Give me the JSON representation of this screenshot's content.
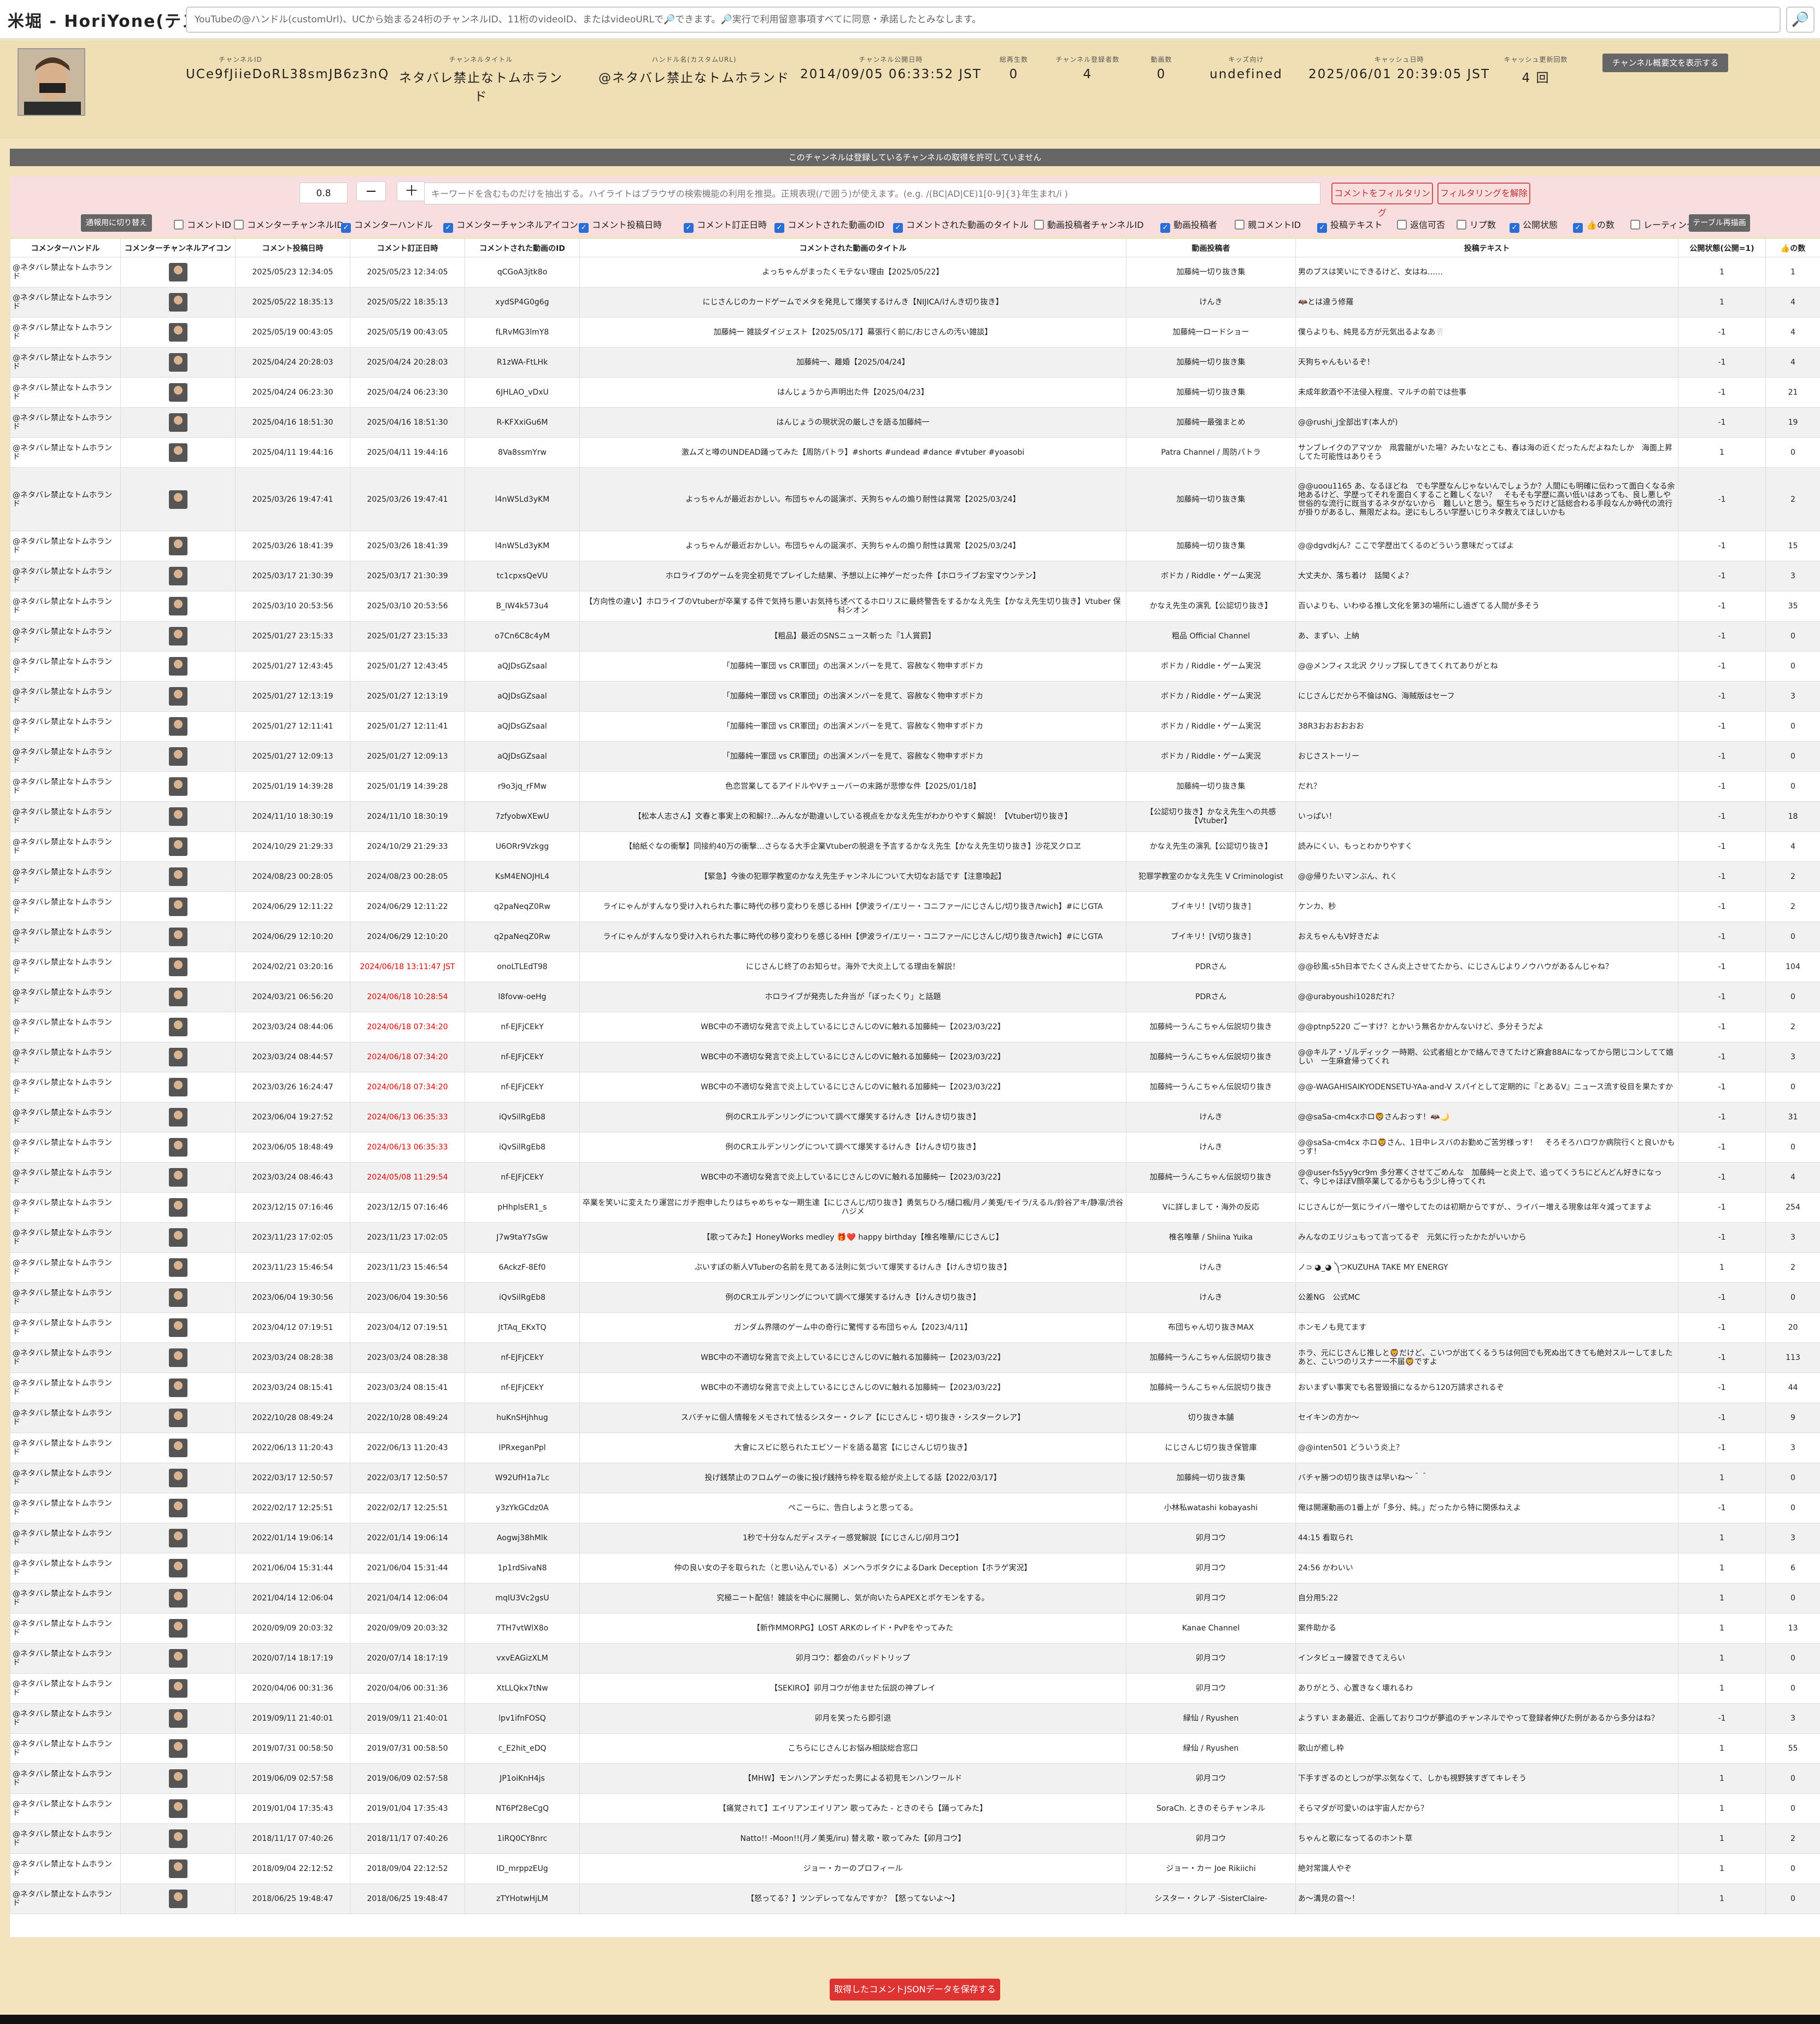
{
  "app_title": "米堀 - HoriYone(テスト中)",
  "search_placeholder": "YouTubeの@ハンドル(customUrl)、UCから始まる24桁のチャンネルID、11桁のvideoID、またはvideoURLで🔎できます。🔎実行で利用留意事項すべてに同意・承諾したとみなします。",
  "search_icon": "🔎",
  "header": [
    {
      "label": "チャンネルID",
      "value": "UCe9fJiieDoRL38smJB6z3nQ"
    },
    {
      "label": "チャンネルタイトル",
      "value": "ネタバレ禁止なトムホランド"
    },
    {
      "label": "ハンドル名(カスタムURL)",
      "value": "@ネタバレ禁止なトムホランド"
    },
    {
      "label": "チャンネル公開日時",
      "value": "2014/09/05 06:33:52 JST"
    },
    {
      "label": "総再生数",
      "value": "0"
    },
    {
      "label": "チャンネル登録者数",
      "value": "4"
    },
    {
      "label": "動画数",
      "value": "0"
    },
    {
      "label": "キッズ向け",
      "value": "undefined"
    },
    {
      "label": "キャッシュ日時",
      "value": "2025/06/01 20:39:05 JST"
    },
    {
      "label": "キャッシュ更新回数",
      "value": "4 回"
    }
  ],
  "desc_button": "チャンネル概要文を表示する",
  "notice": "このチャンネルは登録しているチャンネルの取得を許可していません",
  "filter": {
    "zoom": "0.8",
    "minus": "−",
    "plus": "＋",
    "keyword_placeholder": "キーワードを含むものだけを抽出する。ハイライトはブラウザの検索機能の利用を推奨。正規表現(/で囲う)が使えます。(e.g. /(BC|AD|CE)1[0-9]{3}年生まれ/i )",
    "filter_button": "コメントをフィルタリング",
    "clear_button": "フィルタリングを解除",
    "mode_button": "通報用に切り替え",
    "redraw_button": "テーブル再描画"
  },
  "checkboxes": [
    {
      "label": "コメントID",
      "checked": false
    },
    {
      "label": "コメンターチャンネルID",
      "checked": false
    },
    {
      "label": "コメンターハンドル",
      "checked": true
    },
    {
      "label": "コメンターチャンネルアイコン",
      "checked": true
    },
    {
      "label": "コメント投稿日時",
      "checked": true
    },
    {
      "label": "コメント訂正日時",
      "checked": true
    },
    {
      "label": "コメントされた動画のID",
      "checked": true
    },
    {
      "label": "コメントされた動画のタイトル",
      "checked": true
    },
    {
      "label": "動画投稿者チャンネルID",
      "checked": false
    },
    {
      "label": "動画投稿者",
      "checked": true
    },
    {
      "label": "親コメントID",
      "checked": false
    },
    {
      "label": "投稿テキスト",
      "checked": true
    },
    {
      "label": "返信可否",
      "checked": false
    },
    {
      "label": "リプ数",
      "checked": false
    },
    {
      "label": "公開状態",
      "checked": true
    },
    {
      "label": "👍の数",
      "checked": true
    },
    {
      "label": "レーティング",
      "checked": false
    }
  ],
  "columns": [
    "コメンターハンドル",
    "コメンターチャンネルアイコン",
    "コメント投稿日時",
    "コメント訂正日時",
    "コメントされた動画のID",
    "コメントされた動画のタイトル",
    "動画投稿者",
    "投稿テキスト",
    "公開状態(公開=1)",
    "👍の数"
  ],
  "handle": "@ネタバレ禁止なトムホランド",
  "rows": [
    [
      "2025/05/23 12:34:05",
      "2025/05/23 12:34:05",
      "qCGoA3jtk8o",
      "よっちゃんがまったくモテない理由【2025/05/22】",
      "加藤純一切り抜き集",
      "男のブスは笑いにできるけど、女はね……",
      "1",
      "1"
    ],
    [
      "2025/05/22 18:35:13",
      "2025/05/22 18:35:13",
      "xydSP4G0g6g",
      "にじさんじのカードゲームでメタを発見して爆笑するけんき【NIJICA/けんき切り抜き】",
      "けんき",
      "🦇とは違う修羅",
      "1",
      "4"
    ],
    [
      "2025/05/19 00:43:05",
      "2025/05/19 00:43:05",
      "fLRvMG3lmY8",
      "加藤純一 雑談ダイジェスト【2025/05/17】幕張行く前に/おじさんの汚い雑談】",
      "加藤純一ロードショー",
      "僕らよりも、純見る方が元気出るよなあ🦷",
      "-1",
      "4"
    ],
    [
      "2025/04/24 20:28:03",
      "2025/04/24 20:28:03",
      "R1zWA-FtLHk",
      "加藤純一、離婚【2025/04/24】",
      "加藤純一切り抜き集",
      "天狗ちゃんもいるぞ！",
      "-1",
      "4"
    ],
    [
      "2025/04/24 06:23:30",
      "2025/04/24 06:23:30",
      "6JHLAO_vDxU",
      "はんじょうから声明出た件【2025/04/23】",
      "加藤純一切り抜き集",
      "未成年飲酒や不法侵入程度、マルチの前では些事",
      "-1",
      "21"
    ],
    [
      "2025/04/16 18:51:30",
      "2025/04/16 18:51:30",
      "R-KFXxiGu6M",
      "はんじょうの現状況の厳しさを語る加藤純一",
      "加藤純一最強まとめ",
      "@@rushi_j全部出す(本人が)",
      "-1",
      "19"
    ],
    [
      "2025/04/11 19:44:16",
      "2025/04/11 19:44:16",
      "8Va8ssmYrw",
      "激ムズと噂のUNDEAD踊ってみた【周防パトラ】#shorts #undead #dance #vtuber #yoasobi",
      "Patra Channel / 周防パトラ",
      "サンブレイクのアマツか　凧雲龍がいた場？みたいなとこも、春は海の近くだったんだよねたしか　海面上昇してた可能性はありそう",
      "1",
      "0"
    ],
    [
      "2025/03/26 19:47:41",
      "2025/03/26 19:47:41",
      "l4nW5Ld3yKM",
      "よっちゃんが最近おかしい。布団ちゃんの誕演ボ、天狗ちゃんの煽り耐性は異常【2025/03/24】",
      "加藤純一切り抜き集",
      "@@uoou1165 あ、なるほどね　でも学歴なんじゃないんでしょうか？人間にも明確に伝わって面白くなる余地あるけど、学歴ってそれを面白くすること難しくない？　そもそも学歴に高い低いはあっても、良し悪しや世俗的な流行に既当するネタがないから　難しいと思う。駆生ちゃうだけど話総合わる手段なんか時代の流行が掛りがあるし、無限だよね。逆にもしろい学歴いじりネタ教えてほしいかも",
      "-1",
      "2"
    ],
    [
      "2025/03/26 18:41:39",
      "2025/03/26 18:41:39",
      "l4nW5Ld3yKM",
      "よっちゃんが最近おかしい。布団ちゃんの誕演ボ、天狗ちゃんの煽り耐性は異常【2025/03/24】",
      "加藤純一切り抜き集",
      "@@dgvdkjん？ここで学歴出てくるのどういう意味だってばよ",
      "-1",
      "15"
    ],
    [
      "2025/03/17 21:30:39",
      "2025/03/17 21:30:39",
      "tc1cpxsQeVU",
      "ホロライブのゲームを完全初見でプレイした結果、予想以上に神ゲーだった件【ホロライブお宝マウンテン】",
      "ボドカ / Riddle・ゲーム実況",
      "大丈夫か、落ち着け　話聞くよ？",
      "-1",
      "3"
    ],
    [
      "2025/03/10 20:53:56",
      "2025/03/10 20:53:56",
      "B_IW4k573u4",
      "【方向性の違い】ホロライブのVtuberが卒業する件で気持ち悪いお気持ち述べてるホロリスに最終警告をするかなえ先生【かなえ先生切り抜き】Vtuber 保科シオン",
      "かなえ先生の演乳【公認切り抜き】",
      "百いよりも、いわゆる推し文化を第3の場所にし過ぎてる人間が多そう",
      "-1",
      "35"
    ],
    [
      "2025/01/27 23:15:33",
      "2025/01/27 23:15:33",
      "o7Cn6C8c4yM",
      "【粗品】最近のSNSニュース斬った『1人賞罰】",
      "粗品 Official Channel",
      "あ、まずい、上納",
      "-1",
      "0"
    ],
    [
      "2025/01/27 12:43:45",
      "2025/01/27 12:43:45",
      "aQJDsGZsaal",
      "「加藤純一軍団 vs CR軍団」の出演メンバーを見て、容赦なく物申すボドカ",
      "ボドカ / Riddle・ゲーム実況",
      "@@メンフィス北沢 クリップ探してきてくれてありがとね",
      "-1",
      "0"
    ],
    [
      "2025/01/27 12:13:19",
      "2025/01/27 12:13:19",
      "aQJDsGZsaal",
      "「加藤純一軍団 vs CR軍団」の出演メンバーを見て、容赦なく物申すボドカ",
      "ボドカ / Riddle・ゲーム実況",
      "にじさんじだから不倫はNG、海賊版はセーフ",
      "-1",
      "3"
    ],
    [
      "2025/01/27 12:11:41",
      "2025/01/27 12:11:41",
      "aQJDsGZsaal",
      "「加藤純一軍団 vs CR軍団」の出演メンバーを見て、容赦なく物申すボドカ",
      "ボドカ / Riddle・ゲーム実況",
      "38R3おおおおおお",
      "-1",
      "0"
    ],
    [
      "2025/01/27 12:09:13",
      "2025/01/27 12:09:13",
      "aQJDsGZsaal",
      "「加藤純一軍団 vs CR軍団」の出演メンバーを見て、容赦なく物申すボドカ",
      "ボドカ / Riddle・ゲーム実況",
      "おじさストーリー",
      "-1",
      "0"
    ],
    [
      "2025/01/19 14:39:28",
      "2025/01/19 14:39:28",
      "r9o3jq_rFMw",
      "色恋営業してるアイドルやVチューバーの末路が悲惨な件【2025/01/18】",
      "加藤純一切り抜き集",
      "だれ？",
      "-1",
      "0"
    ],
    [
      "2024/11/10 18:30:19",
      "2024/11/10 18:30:19",
      "7zfyobwXEwU",
      "【松本人志さん】文春と事実上の和解!?…みんなが勘違いしている視点をかなえ先生がわかりやすく解説！【Vtuber切り抜き】",
      "【公認切り抜き】かなえ先生への共感【Vtuber】",
      "いっぱい！",
      "-1",
      "18"
    ],
    [
      "2024/10/29 21:29:33",
      "2024/10/29 21:29:33",
      "U6ORr9Vzkgg",
      "【給紙ぐなの衝撃】同接約40万の衝撃…さらなる大手企業Vtuberの脱退を予言するかなえ先生【かなえ先生切り抜き】沙花叉クロヱ",
      "かなえ先生の演乳【公認切り抜き】",
      "読みにくい、もっとわかりやすく",
      "-1",
      "4"
    ],
    [
      "2024/08/23 00:28:05",
      "2024/08/23 00:28:05",
      "KsM4ENOJHL4",
      "【緊急】今後の犯罪学教室のかなえ先生チャンネルについて大切なお話です【注意喚起】",
      "犯罪学教室のかなえ先生 V Criminologist",
      "@@帰りたいマンぶん、れく",
      "-1",
      "2"
    ],
    [
      "2024/06/29 12:11:22",
      "2024/06/29 12:11:22",
      "q2paNeqZ0Rw",
      "ライにゃんがすんなり受け入れられた事に時代の移り変わりを感じるHH【伊波ライ/エリー・コニファー/にじさんじ/切り抜き/twich】#にじGTA",
      "ブイキリ！[V切り抜き]",
      "ケンカ、秒",
      "-1",
      "2"
    ],
    [
      "2024/06/29 12:10:20",
      "2024/06/29 12:10:20",
      "q2paNeqZ0Rw",
      "ライにゃんがすんなり受け入れられた事に時代の移り変わりを感じるHH【伊波ライ/エリー・コニファー/にじさんじ/切り抜き/twich】#にじGTA",
      "ブイキリ！[V切り抜き]",
      "おえちゃんもV好きだよ",
      "-1",
      "0"
    ],
    [
      "2024/02/21 03:20:16",
      "2024/06/18 13:11:47 JST",
      "onoLTLEdT98",
      "にじさんじ終了のお知らせ。海外で大炎上してる理由を解説！",
      "PDRさん",
      "@@砂風-s5h日本でたくさん炎上させてたから、にじさんじよりノウハウがあるんじゃね？",
      "-1",
      "104"
    ],
    [
      "2024/03/21 06:56:20",
      "2024/06/18 10:28:54",
      "l8fovw-oeHg",
      "ホロライブが発売した弁当が「ぼったくり」と話題",
      "PDRさん",
      "@@urabyoushi1028だれ？",
      "-1",
      "0"
    ],
    [
      "2023/03/24 08:44:06",
      "2024/06/18 07:34:20",
      "nf-EJFjCEkY",
      "WBC中の不適切な発言で炎上しているにじさんじのVに触れる加藤純一【2023/03/22】",
      "加藤純一うんこちゃん伝説切り抜き",
      "@@ptnp5220 ごーすけ？とかいう無名かかんないけど、多分そうだよ",
      "-1",
      "2"
    ],
    [
      "2023/03/24 08:44:57",
      "2024/06/18 07:34:20",
      "nf-EJFjCEkY",
      "WBC中の不適切な発言で炎上しているにじさんじのVに触れる加藤純一【2023/03/22】",
      "加藤純一うんこちゃん伝説切り抜き",
      "@@キルア・ゾルディック 一時期、公式者組とかで絡んできてたけど麻倉88Aになってから閉じコンしてて嬉しい　一生麻倉帰ってくれ",
      "-1",
      "3"
    ],
    [
      "2023/03/26 16:24:47",
      "2024/06/18 07:34:20",
      "nf-EJFjCEkY",
      "WBC中の不適切な発言で炎上しているにじさんじのVに触れる加藤純一【2023/03/22】",
      "加藤純一うんこちゃん伝説切り抜き",
      "@@-WAGAHISAIKYODENSETU-YAa-and-V スパイとして定期的に『とあるV』ニュース流す役目を果たすか",
      "-1",
      "0"
    ],
    [
      "2023/06/04 19:27:52",
      "2024/06/13 06:35:33",
      "iQvSilRgEb8",
      "例のCRエルデンリングについて調べて爆笑するけんき【けんき切り抜き】",
      "けんき",
      "@@saSa-cm4cxホロ🦁さんおっす！🦇🌙",
      "-1",
      "31"
    ],
    [
      "2023/06/05 18:48:49",
      "2024/06/13 06:35:33",
      "iQvSilRgEb8",
      "例のCRエルデンリングについて調べて爆笑するけんき【けんき切り抜き】",
      "けんき",
      "@@saSa-cm4cx ホロ🦁さん、1日中レスバのお勤めご苦労様っす！　そろそろハロワか病院行くと良いかもっす！",
      "-1",
      "0"
    ],
    [
      "2023/03/24 08:46:43",
      "2024/05/08 11:29:54",
      "nf-EJFjCEkY",
      "WBC中の不適切な発言で炎上しているにじさんじのVに触れる加藤純一【2023/03/22】",
      "加藤純一うんこちゃん伝説切り抜き",
      "@@user-fs5yy9cr9m 多分寒くさせてごめんな　加藤純一と炎上で、追ってくうちにどんどん好きになって、今じゃほぼV顔卒業してるからもう少し待ってくれ",
      "-1",
      "4"
    ],
    [
      "2023/12/15 07:16:46",
      "2023/12/15 07:16:46",
      "pHhplsER1_s",
      "卒業を笑いに変えたり運営にガチ抱申したりはちゃめちゃな一期生達【にじさんじ/切り抜き】勇気ちひろ/樋口楓/月ノ美兎/モイラ/えるル/鈴谷アキ/静凛/渋谷ハジメ",
      "Vに詳しまして・海外の反応",
      "にじさんじが一気にライバー増やしてたのは初期からですが、、ライバー増える現象は年々減ってますよ",
      "-1",
      "254"
    ],
    [
      "2023/11/23 17:02:05",
      "2023/11/23 17:02:05",
      "J7w9taY7sGw",
      "【歌ってみた】HoneyWorks medley 🎁❤️ happy birthday【椎名唯華/にじさんじ】",
      "椎名唯華 / Shiina Yuika",
      "みんなのエリジュもって言ってるぞ　元気に行ったかたがいいから",
      "-1",
      "3"
    ],
    [
      "2023/11/23 15:46:54",
      "2023/11/23 15:46:54",
      "6AckzF-8Ef0",
      "ぶいすぽの新人VTuberの名前を見てある法則に気づいて爆笑するけんき【けんき切り抜き】",
      "けんき",
      "ノ⊃ ◕_◕ ༽つKUZUHA TAKE MY ENERGY",
      "1",
      "2"
    ],
    [
      "2023/06/04 19:30:56",
      "2023/06/04 19:30:56",
      "iQvSilRgEb8",
      "例のCRエルデンリングについて調べて爆笑するけんき【けんき切り抜き】",
      "けんき",
      "公差NG　公式MC",
      "-1",
      "0"
    ],
    [
      "2023/04/12 07:19:51",
      "2023/04/12 07:19:51",
      "JtTAq_EKxTQ",
      "ガンダム界隈のゲーム中の奇行に驚愕する布団ちゃん【2023/4/11】",
      "布団ちゃん切り抜きMAX",
      "ホンモノも見てます",
      "-1",
      "20"
    ],
    [
      "2023/03/24 08:28:38",
      "2023/03/24 08:28:38",
      "nf-EJFjCEkY",
      "WBC中の不適切な発言で炎上しているにじさんじのVに触れる加藤純一【2023/03/22】",
      "加藤純一うんこちゃん伝説切り抜き",
      "ホラ、元にじさんじ推しと🦁だけど、こいつが出てくるうちは何回でも死ぬ出てきても絶対スルーしてました　あと、こいつのリスナー一不届🦁ですよ",
      "-1",
      "113"
    ],
    [
      "2023/03/24 08:15:41",
      "2023/03/24 08:15:41",
      "nf-EJFjCEkY",
      "WBC中の不適切な発言で炎上しているにじさんじのVに触れる加藤純一【2023/03/22】",
      "加藤純一うんこちゃん伝説切り抜き",
      "おいまずい事実でも名誉毀損になるから120万請求されるぞ",
      "-1",
      "44"
    ],
    [
      "2022/10/28 08:49:24",
      "2022/10/28 08:49:24",
      "huKnSHjhhug",
      "スバチャに個人情報をメモされて怯るシスター・クレア【にじさんじ・切り抜き・シスタークレア】",
      "切り抜き本舗",
      "セイキンの方か〜",
      "-1",
      "9"
    ],
    [
      "2022/06/13 11:20:43",
      "2022/06/13 11:20:43",
      "IPRxeganPpl",
      "大會にスビに怒られたエピソードを語る葛宮【にじさんじ切り抜き】",
      "にじさんじ切り抜き保管庫",
      "@@inten501 どういう炎上？",
      "-1",
      "3"
    ],
    [
      "2022/03/17 12:50:57",
      "2022/03/17 12:50:57",
      "W92UfH1a7Lc",
      "投げ銭禁止のフロムゲーの後に投げ銭持ち枠を取る絵が炎上してる話【2022/03/17】",
      "加藤純一切り抜き集",
      "バチャ勝つの切り抜きは早いね〜＾＾",
      "1",
      "0"
    ],
    [
      "2022/02/17 12:25:51",
      "2022/02/17 12:25:51",
      "y3zYkGCdz0A",
      "ぺこーらに、告白しようと思ってる。",
      "小林私watashi kobayashi",
      "俺は開運動画の1番上が「多分、純。」だったから特に関係ねえよ",
      "-1",
      "0"
    ],
    [
      "2022/01/14 19:06:14",
      "2022/01/14 19:06:14",
      "Aogwj38hMlk",
      "1秒で十分なんだディスティー感覚解説【にじさんじ/卯月コウ】",
      "卯月コウ",
      "44:15 看取られ",
      "1",
      "3"
    ],
    [
      "2021/06/04 15:31:44",
      "2021/06/04 15:31:44",
      "1p1rdSivaN8",
      "仲の良い女の子を取られた（と思い込んでいる）メンヘラボタクによるDark Deception【ホラゲ実況】",
      "卯月コウ",
      "24:56 かわいい",
      "1",
      "6"
    ],
    [
      "2021/04/14 12:06:04",
      "2021/04/14 12:06:04",
      "mqlU3Vc2gsU",
      "究極ニート配信！雑談を中心に展開し、気が向いたらAPEXとポケモンをする。",
      "卯月コウ",
      "自分用5:22",
      "1",
      "0"
    ],
    [
      "2020/09/09 20:03:32",
      "2020/09/09 20:03:32",
      "7TH7vtWlX8o",
      "【新作MMORPG】LOST ARKのレイド・PvPをやってみた",
      "Kanae Channel",
      "案件助かる",
      "1",
      "13"
    ],
    [
      "2020/07/14 18:17:19",
      "2020/07/14 18:17:19",
      "vxvEAGizXLM",
      "卯月コウ：都会のバッドトリップ",
      "卯月コウ",
      "インタビュー練習できてえらい",
      "1",
      "0"
    ],
    [
      "2020/04/06 00:31:36",
      "2020/04/06 00:31:36",
      "XtLLQkx7tNw",
      "【SEKIRO】卯月コウが他ませた伝説の神プレイ",
      "卯月コウ",
      "ありがとう、心置きなく壊れるわ",
      "1",
      "0"
    ],
    [
      "2019/09/11 21:40:01",
      "2019/09/11 21:40:01",
      "lpv1ifnFOSQ",
      "卯月を笑ったら即引退",
      "緑仙 / Ryushen",
      "ようすい まあ最近、企画しておりコウが夢追のチャンネルでやって登録者伸びた例があるから多分はね？",
      "-1",
      "3"
    ],
    [
      "2019/07/31 00:58:50",
      "2019/07/31 00:58:50",
      "c_E2hit_eDQ",
      "こちらにじさんじお悩み相談総合窓口",
      "緑仙 / Ryushen",
      "歌山が癒し枠",
      "1",
      "55"
    ],
    [
      "2019/06/09 02:57:58",
      "2019/06/09 02:57:58",
      "JP1oiKnH4js",
      "【MHW】モンハンアンチだった男による初見モンハンワールド",
      "卯月コウ",
      "下手すぎるのとしつが学ぶ気なくて、しかも視野狭すぎてキレそう",
      "1",
      "0"
    ],
    [
      "2019/01/04 17:35:43",
      "2019/01/04 17:35:43",
      "NT6Pf28eCgQ",
      "【痛覚されて】エイリアンエイリアン 歌ってみた - ときのそら【踊ってみた】",
      "SoraCh. ときのそらチャンネル",
      "そらマダが可愛いのは宇宙人だから？",
      "1",
      "0"
    ],
    [
      "2018/11/17 07:40:26",
      "2018/11/17 07:40:26",
      "1iRQ0CY8nrc",
      "Natto!! -Moon!!(月ノ美兎/iru) 替え歌・歌ってみた【卯月コウ】",
      "卯月コウ",
      "ちゃんと歌になってるのホント草",
      "1",
      "2"
    ],
    [
      "2018/09/04 22:12:52",
      "2018/09/04 22:12:52",
      "ID_mrppzEUg",
      "ジョー・カーのプロフィール",
      "ジョー・カー Joe Rikiichi",
      "絶対常識人やぞ",
      "1",
      "0"
    ],
    [
      "2018/06/25 19:48:47",
      "2018/06/25 19:48:47",
      "zTYHotwHjLM",
      "【怒ってる？】ツンデレってなんですか？【怒ってないよ〜】",
      "シスター・クレア -SisterClaire-",
      "あ〜溝見の音〜！",
      "1",
      "0"
    ]
  ],
  "save_button": "取得したコメントJSONデータを保存する"
}
